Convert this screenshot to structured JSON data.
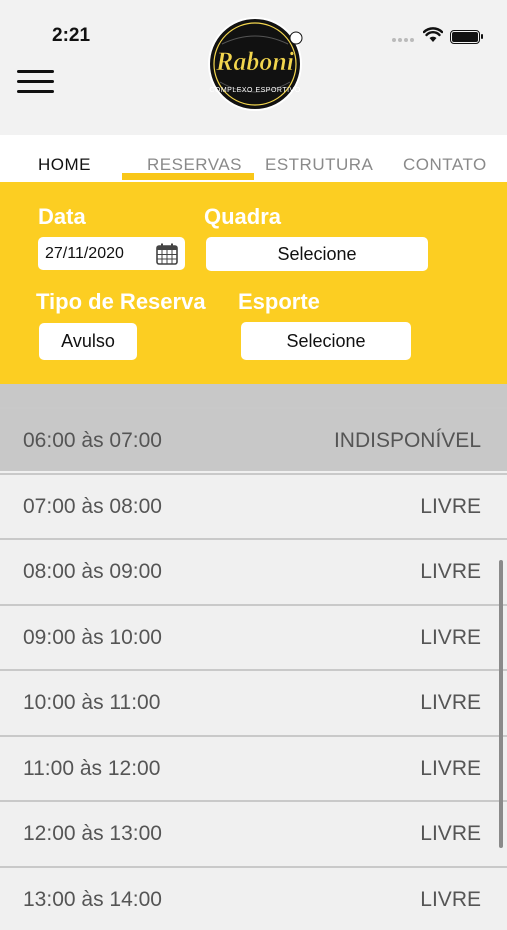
{
  "status_bar": {
    "time": "2:21"
  },
  "header": {
    "logo_name": "Raboni",
    "logo_subtitle": "COMPLEXO ESPORTIVO"
  },
  "tabs": [
    {
      "label": "HOME"
    },
    {
      "label": "RESERVAS"
    },
    {
      "label": "ESTRUTURA"
    },
    {
      "label": "CONTATO"
    }
  ],
  "filters": {
    "date_label": "Data",
    "date_value": "27/11/2020",
    "quadra_label": "Quadra",
    "quadra_value": "Selecione",
    "tipo_label": "Tipo de Reserva",
    "tipo_value": "Avulso",
    "esporte_label": "Esporte",
    "esporte_value": "Selecione"
  },
  "slots": [
    {
      "time": "06:00 às 07:00",
      "status": "INDISPONÍVEL"
    },
    {
      "time": "07:00 às 08:00",
      "status": "LIVRE"
    },
    {
      "time": "08:00 às 09:00",
      "status": "LIVRE"
    },
    {
      "time": "09:00 às 10:00",
      "status": "LIVRE"
    },
    {
      "time": "10:00 às 11:00",
      "status": "LIVRE"
    },
    {
      "time": "11:00 às 12:00",
      "status": "LIVRE"
    },
    {
      "time": "12:00 às 13:00",
      "status": "LIVRE"
    },
    {
      "time": "13:00 às 14:00",
      "status": "LIVRE"
    }
  ],
  "colors": {
    "accent": "#fcce22",
    "tab_indicator": "#f9c718",
    "unavailable_row": "#c8c8c8"
  }
}
